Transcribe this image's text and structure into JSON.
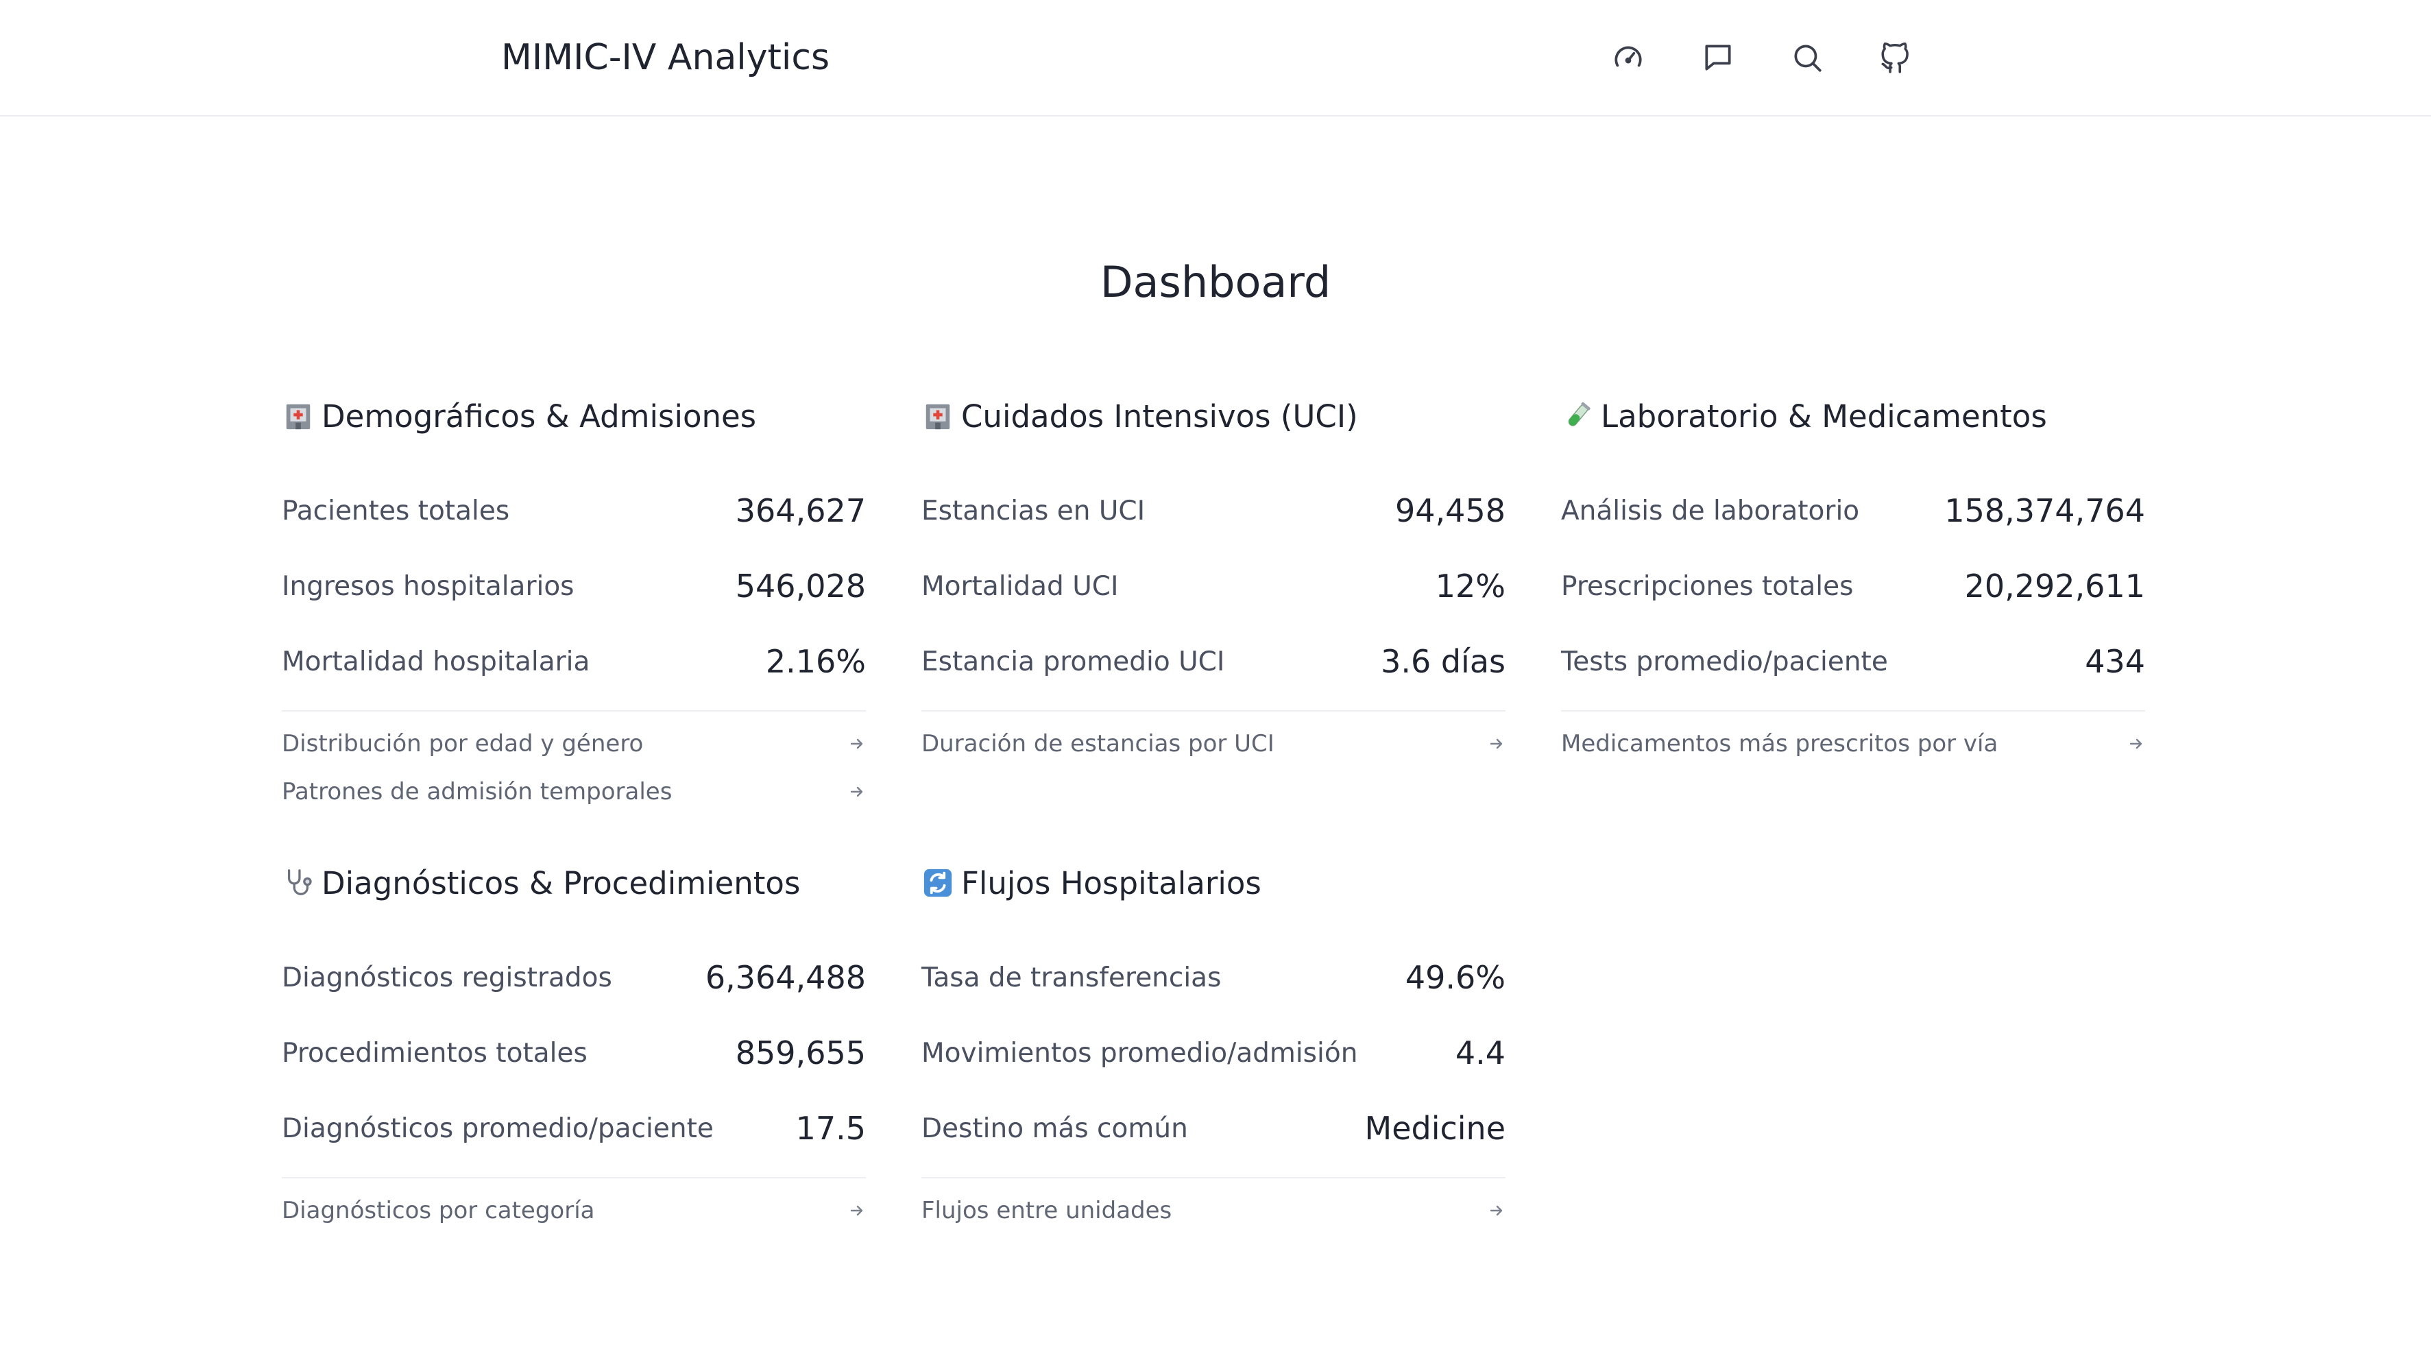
{
  "app": {
    "title": "MIMIC-IV Analytics",
    "nav_icons": [
      "dashboard-gauge-icon",
      "chat-icon",
      "search-icon",
      "github-icon"
    ]
  },
  "page": {
    "title": "Dashboard"
  },
  "cards": [
    {
      "icon": "hospital-icon",
      "title": "Demográficos & Admisiones",
      "stats": [
        {
          "label": "Pacientes totales",
          "value": "364,627"
        },
        {
          "label": "Ingresos hospitalarios",
          "value": "546,028"
        },
        {
          "label": "Mortalidad hospitalaria",
          "value": "2.16%"
        }
      ],
      "links": [
        {
          "label": "Distribución por edad y género"
        },
        {
          "label": "Patrones de admisión temporales"
        }
      ]
    },
    {
      "icon": "hospital-icon",
      "title": "Cuidados Intensivos (UCI)",
      "stats": [
        {
          "label": "Estancias en UCI",
          "value": "94,458"
        },
        {
          "label": "Mortalidad UCI",
          "value": "12%"
        },
        {
          "label": "Estancia promedio UCI",
          "value": "3.6 días"
        }
      ],
      "links": [
        {
          "label": "Duración de estancias por UCI"
        }
      ]
    },
    {
      "icon": "test-tube-icon",
      "title": "Laboratorio & Medicamentos",
      "stats": [
        {
          "label": "Análisis de laboratorio",
          "value": "158,374,764"
        },
        {
          "label": "Prescripciones totales",
          "value": "20,292,611"
        },
        {
          "label": "Tests promedio/paciente",
          "value": "434"
        }
      ],
      "links": [
        {
          "label": "Medicamentos más prescritos por vía"
        }
      ]
    },
    {
      "icon": "stethoscope-icon",
      "title": "Diagnósticos & Procedimientos",
      "stats": [
        {
          "label": "Diagnósticos registrados",
          "value": "6,364,488"
        },
        {
          "label": "Procedimientos totales",
          "value": "859,655"
        },
        {
          "label": "Diagnósticos promedio/paciente",
          "value": "17.5"
        }
      ],
      "links": [
        {
          "label": "Diagnósticos por categoría"
        }
      ]
    },
    {
      "icon": "refresh-arrows-icon",
      "title": "Flujos Hospitalarios",
      "stats": [
        {
          "label": "Tasa de transferencias",
          "value": "49.6%"
        },
        {
          "label": "Movimientos promedio/admisión",
          "value": "4.4"
        },
        {
          "label": "Destino más común",
          "value": "Medicine"
        }
      ],
      "links": [
        {
          "label": "Flujos entre unidades"
        }
      ]
    }
  ],
  "colors": {
    "text_primary": "#1f2430",
    "text_secondary": "#4a5060",
    "link_text": "#5f6573",
    "divider": "#eceef1"
  }
}
